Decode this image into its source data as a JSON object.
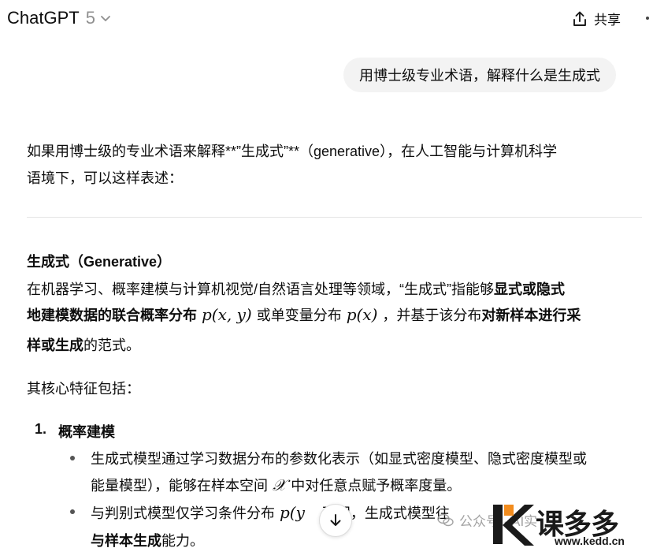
{
  "header": {
    "app_title": "ChatGPT",
    "model_version": "5",
    "share_label": "共享"
  },
  "user_message": "用博士级专业术语，解释什么是生成式",
  "response": {
    "intro_line1": "如果用博士级的专业术语来解释**”生成式”**（generative），在人工智能与计算机科学",
    "intro_line2": "语境下，可以这样表述：",
    "section_title": "生成式（Generative）",
    "p1_seg1": "在机器学习、概率建模与计算机视觉/自然语言处理等领域，“生成式”指能够",
    "p1_bold1": "显式或隐式",
    "p1_bold2": "地建模数据的联合概率分布",
    "math_joint": "p(x, y)",
    "p1_seg2": "或单变量分布",
    "math_marginal": "p(x)",
    "p1_seg3": "，并基于该分布",
    "p1_bold3": "对新样本进行采",
    "p1_bold4": "样或生成",
    "p1_seg4": "的范式。",
    "core_intro": "其核心特征包括：",
    "list_item_number": "1.",
    "list_item_title": "概率建模",
    "b1_line1": "生成式模型通过学习数据分布的参数化表示（如显式密度模型、隐式密度模型或",
    "b1_line2a": "能量模型），能够在样本空间",
    "math_space": "𝒳",
    "b1_line2b": "中对任意点赋予概率度量。",
    "b2_line1a": "与判别式模型仅学习条件分布",
    "math_cond": "p(y",
    "b2_line1b": "不同，生成式模型往",
    "b2_line2_bold": "与样本生成",
    "b2_line2_rest": "能力。"
  },
  "watermark": {
    "text": "公众号 · AI实",
    "brand": "课多多",
    "url": "www.kedd.cn"
  },
  "colors": {
    "bubble": "#f3f3f3",
    "divider": "#e3e3e3",
    "muted": "#8f8f8f",
    "logo_orange": "#f28c1e"
  },
  "icons": [
    "chevron-down-icon",
    "share-icon",
    "more-icon",
    "arrow-down-icon",
    "wechat-icon",
    "logo-icon"
  ]
}
